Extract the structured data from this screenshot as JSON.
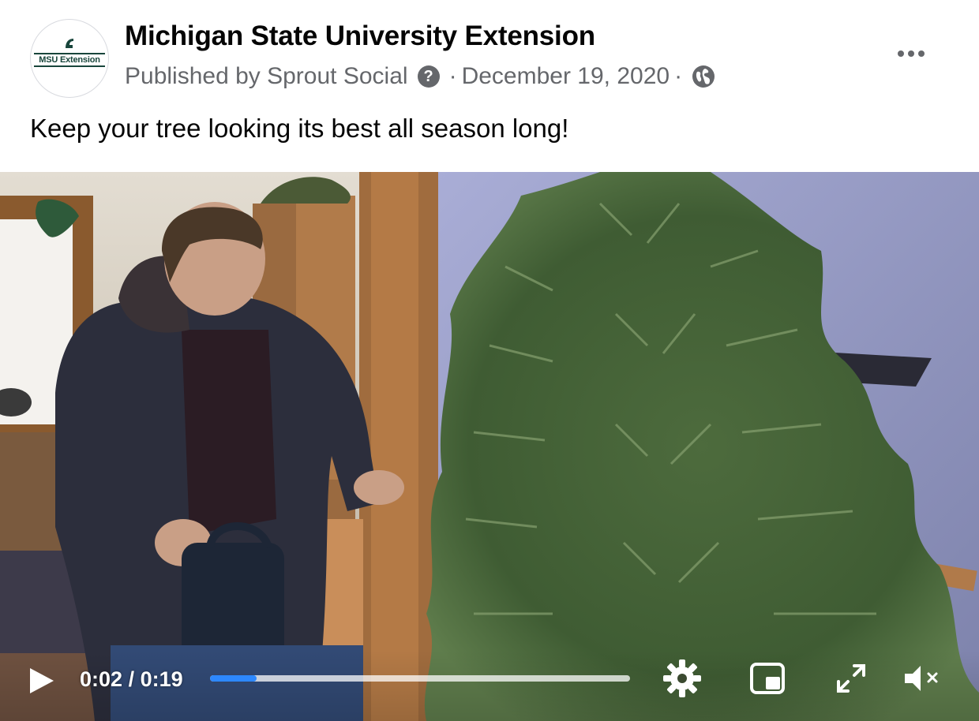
{
  "post": {
    "page_name": "Michigan State University Extension",
    "avatar_text": "MSU Extension",
    "published_by": "Published by Sprout Social",
    "help_icon": "question-circle-icon",
    "separator": "·",
    "date": "December 19, 2020",
    "audience_icon": "globe-icon",
    "more_icon": "more-options-icon",
    "text": "Keep your tree looking its best all season long!"
  },
  "video": {
    "current_time": "0:02",
    "separator": "/",
    "duration": "0:19",
    "progress": 0.11,
    "controls": {
      "play_icon": "play-icon",
      "settings_icon": "gear-icon",
      "pip_icon": "picture-in-picture-icon",
      "fullscreen_icon": "fullscreen-icon",
      "volume_icon": "muted-speaker-icon"
    }
  },
  "colors": {
    "text_primary": "#050505",
    "text_secondary": "#65676b",
    "progress_accent": "#2d88ff",
    "msu_green": "#18453b"
  }
}
